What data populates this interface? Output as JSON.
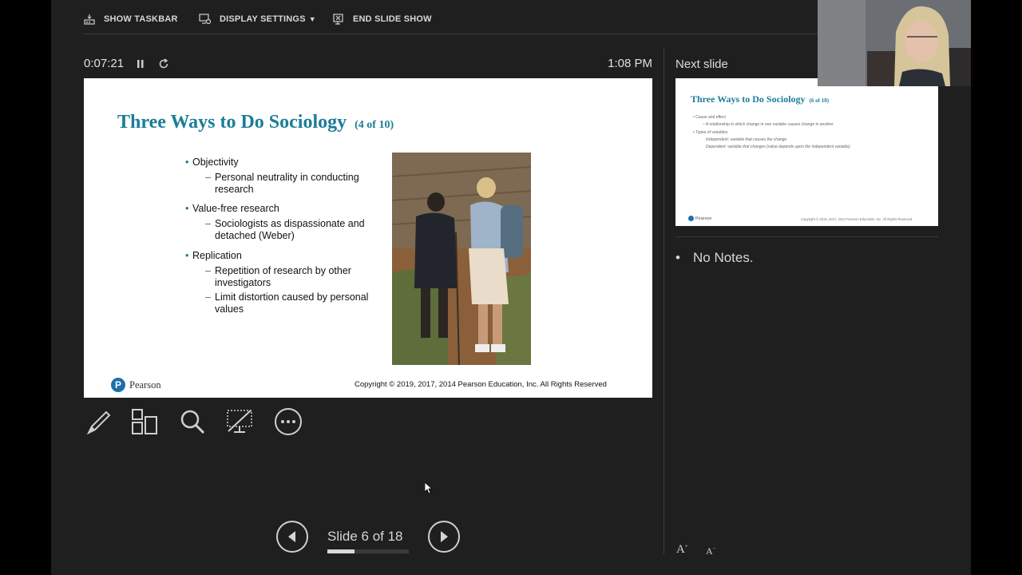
{
  "toolbar": {
    "show_taskbar": "SHOW TASKBAR",
    "display_settings": "DISPLAY SETTINGS",
    "end_slide_show": "END SLIDE SHOW"
  },
  "timer": {
    "elapsed": "0:07:21",
    "clock": "1:08 PM"
  },
  "slide": {
    "title": "Three Ways to Do Sociology",
    "title_count": "(4 of 10)",
    "bullets": [
      {
        "label": "Objectivity",
        "subs": [
          "Personal neutrality in conducting",
          "research"
        ]
      },
      {
        "label": "Value-free research",
        "subs": [
          "Sociologists as dispassionate and",
          "detached (Weber)"
        ]
      },
      {
        "label": "Replication",
        "subs": [
          "Repetition of research by other",
          "investigators",
          "Limit distortion caused by personal",
          "values"
        ]
      }
    ],
    "logo": "Pearson",
    "copyright": "Copyright © 2019, 2017, 2014 Pearson Education, Inc. All Rights Reserved"
  },
  "next_slide": {
    "label": "Next slide",
    "title": "Three Ways to Do Sociology",
    "title_count": "(6 of 10)",
    "lines": [
      "Cause and effect",
      "A relationship in which change in one variable causes change in another",
      "Types of variables",
      "Independent: variable that causes the change",
      "Dependent: variable that changes (value depends upon the independent variable)"
    ],
    "logo": "Pearson",
    "copyright": "Copyright © 2019, 2017, 2014 Pearson Education, Inc. All Rights Reserved"
  },
  "notes": {
    "text": "No Notes."
  },
  "navigation": {
    "slide_counter": "Slide 6 of 18",
    "progress": 0.333
  },
  "font_buttons": {
    "increase": "A",
    "decrease": "A"
  },
  "icons": [
    "taskbar-icon",
    "display-settings-icon",
    "end-show-icon",
    "pause-icon",
    "reset-icon",
    "pen-icon",
    "all-slides-icon",
    "zoom-icon",
    "black-screen-icon",
    "more-options-icon",
    "previous-icon",
    "next-icon"
  ]
}
